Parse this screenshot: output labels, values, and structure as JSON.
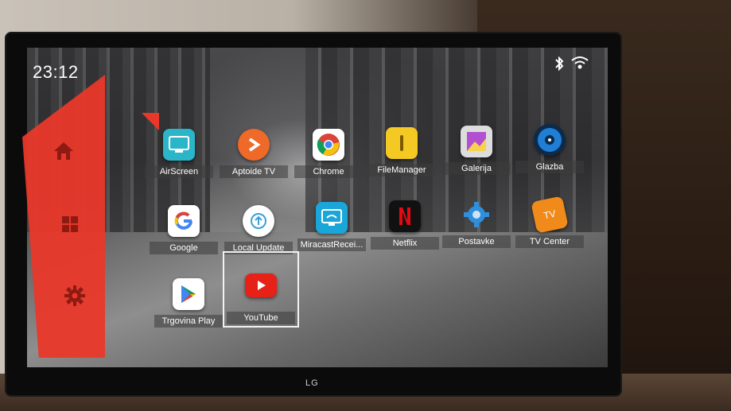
{
  "status_bar": {
    "time": "23:12",
    "icons": [
      "bluetooth-icon",
      "wifi-icon"
    ]
  },
  "sidebar": {
    "items": [
      {
        "name": "home",
        "icon": "home-icon"
      },
      {
        "name": "apps",
        "icon": "grid-icon"
      },
      {
        "name": "settings",
        "icon": "gear-icon"
      }
    ],
    "accent_color": "#e9382a"
  },
  "apps": [
    {
      "id": "airscreen",
      "label": "AirScreen",
      "icon": "airscreen-icon",
      "color": "#2bb5c9"
    },
    {
      "id": "aptoide",
      "label": "Aptoide TV",
      "icon": "aptoide-icon",
      "color": "#ef6a28"
    },
    {
      "id": "chrome",
      "label": "Chrome",
      "icon": "chrome-icon",
      "color": "#ffffff"
    },
    {
      "id": "filemanager",
      "label": "FileManager",
      "icon": "filemanager-icon",
      "color": "#f4c924"
    },
    {
      "id": "galerija",
      "label": "Galerija",
      "icon": "gallery-icon",
      "color": "#b34fd1"
    },
    {
      "id": "glazba",
      "label": "Glazba",
      "icon": "music-icon",
      "color": "#1f7fd6"
    },
    {
      "id": "google",
      "label": "Google",
      "icon": "google-icon",
      "color": "#ffffff"
    },
    {
      "id": "localupdate",
      "label": "Local Update",
      "icon": "update-icon",
      "color": "#ffffff"
    },
    {
      "id": "miracast",
      "label": "MiracastRecei...",
      "icon": "miracast-icon",
      "color": "#1aa6d8"
    },
    {
      "id": "netflix",
      "label": "Netflix",
      "icon": "netflix-icon",
      "color": "#111111"
    },
    {
      "id": "postavke",
      "label": "Postavke",
      "icon": "settings-icon",
      "color": "#2f8fdc"
    },
    {
      "id": "tvcenter",
      "label": "TV Center",
      "icon": "tvcenter-icon",
      "color": "#f08a1a"
    },
    {
      "id": "trgovinaplay",
      "label": "Trgovina Play",
      "icon": "playstore-icon",
      "color": "#ffffff"
    },
    {
      "id": "youtube",
      "label": "YouTube",
      "icon": "youtube-icon",
      "color": "#e62117",
      "focused": true
    }
  ],
  "tv_center_glyph": "TV",
  "brand": "LG"
}
